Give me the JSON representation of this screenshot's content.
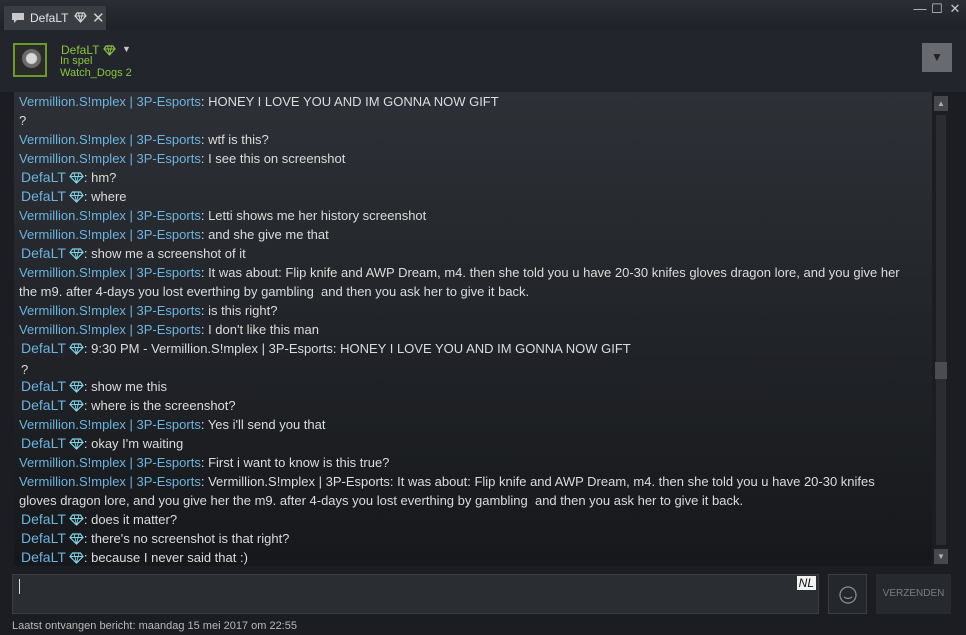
{
  "window": {
    "tab_title": "DefaLT",
    "tab_close": "✕",
    "minimize": "—",
    "maximize": "☐",
    "close": "✕"
  },
  "header": {
    "name": "DefaLT",
    "status": "In spel",
    "game": "Watch_Dogs 2",
    "options_icon": "▼"
  },
  "colors": {
    "online_green": "#8bc53f",
    "sender_blue": "#6cb4e0",
    "gem_cyan": "#7fd4e8"
  },
  "messages": [
    {
      "sender": "Vermillion.S!mplex | 3P-Esports",
      "text": ": HONEY I LOVE YOU AND IM GONNA NOW GIFT\n?"
    },
    {
      "sender": "Vermillion.S!mplex | 3P-Esports",
      "text": ": wtf is this?"
    },
    {
      "sender": "Vermillion.S!mplex | 3P-Esports",
      "text": ": I see this on screenshot"
    },
    {
      "sender": "DefaLT",
      "text": ": hm?"
    },
    {
      "sender": "DefaLT",
      "text": ": where"
    },
    {
      "sender": "Vermillion.S!mplex | 3P-Esports",
      "text": ": Letti shows me her history screenshot"
    },
    {
      "sender": "Vermillion.S!mplex | 3P-Esports",
      "text": ": and she give me that"
    },
    {
      "sender": "DefaLT",
      "text": ": show me a screenshot of it"
    },
    {
      "sender": "Vermillion.S!mplex | 3P-Esports",
      "text": ": It was about: Flip knife and AWP Dream, m4. then she told you u have 20-30 knifes gloves dragon lore, and you give her\nthe m9. after 4-days you lost everthing by gambling  and then you ask her to give it back."
    },
    {
      "sender": "Vermillion.S!mplex | 3P-Esports",
      "text": ": is this right?"
    },
    {
      "sender": "Vermillion.S!mplex | 3P-Esports",
      "text": ": I don't like this man"
    },
    {
      "sender": "DefaLT",
      "text": ": 9:30 PM - Vermillion.S!mplex | 3P-Esports: HONEY I LOVE YOU AND IM GONNA NOW GIFT\n?"
    },
    {
      "sender": "DefaLT",
      "text": ": show me this"
    },
    {
      "sender": "DefaLT",
      "text": ": where is the screenshot?"
    },
    {
      "sender": "Vermillion.S!mplex | 3P-Esports",
      "text": ": Yes i'll send you that"
    },
    {
      "sender": "DefaLT",
      "text": ": okay I'm waiting"
    },
    {
      "sender": "Vermillion.S!mplex | 3P-Esports",
      "text": ": First i want to know is this true?"
    },
    {
      "sender": "Vermillion.S!mplex | 3P-Esports",
      "text": ": Vermillion.S!mplex | 3P-Esports: It was about: Flip knife and AWP Dream, m4. then she told you u have 20-30 knifes\ngloves dragon lore, and you give her the m9. after 4-days you lost everthing by gambling  and then you ask her to give it back."
    },
    {
      "sender": "DefaLT",
      "text": ": does it matter?"
    },
    {
      "sender": "DefaLT",
      "text": ": there's no screenshot is that right?"
    },
    {
      "sender": "DefaLT",
      "text": ": because I never said that :)"
    }
  ],
  "input": {
    "value": "",
    "language_badge": "NL"
  },
  "send_button": "VERZENDEN",
  "emoji_icon": "smiley-icon",
  "footer": "Laatst ontvangen bericht: maandag 15 mei 2017 om 22:55",
  "scrollbar": {
    "up": "▲",
    "down": "▼"
  }
}
